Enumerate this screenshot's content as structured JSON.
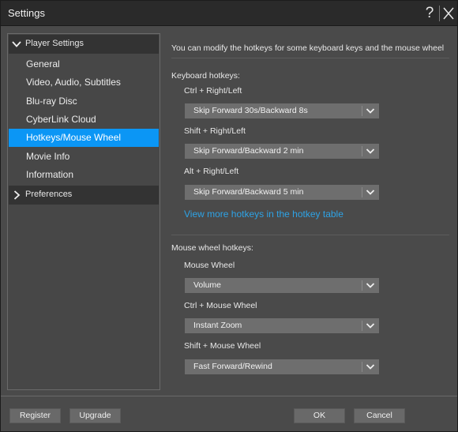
{
  "window": {
    "title": "Settings",
    "help_label": "?",
    "icons": {
      "help": "question-mark-icon",
      "close": "close-x-icon"
    }
  },
  "sidebar": {
    "groups": [
      {
        "label": "Player Settings",
        "expanded": true,
        "icon": "chevron-down-icon",
        "items": [
          {
            "label": "General",
            "active": false
          },
          {
            "label": "Video, Audio, Subtitles",
            "active": false
          },
          {
            "label": "Blu-ray Disc",
            "active": false
          },
          {
            "label": "CyberLink Cloud",
            "active": false
          },
          {
            "label": "Hotkeys/Mouse Wheel",
            "active": true
          },
          {
            "label": "Movie Info",
            "active": false
          },
          {
            "label": "Information",
            "active": false
          }
        ]
      },
      {
        "label": "Preferences",
        "expanded": false,
        "icon": "chevron-right-icon",
        "items": []
      }
    ]
  },
  "main": {
    "intro": "You can modify the hotkeys for some keyboard keys and the mouse wheel",
    "keyboard": {
      "heading": "Keyboard hotkeys:",
      "entries": [
        {
          "label": "Ctrl + Right/Left",
          "value": "Skip Forward 30s/Backward 8s"
        },
        {
          "label": "Shift + Right/Left",
          "value": "Skip Forward/Backward 2 min"
        },
        {
          "label": "Alt + Right/Left",
          "value": "Skip Forward/Backward 5 min"
        }
      ],
      "link": "View more hotkeys in the hotkey table"
    },
    "mouse": {
      "heading": "Mouse wheel hotkeys:",
      "entries": [
        {
          "label": "Mouse Wheel",
          "value": "Volume"
        },
        {
          "label": "Ctrl + Mouse Wheel",
          "value": "Instant Zoom"
        },
        {
          "label": "Shift + Mouse Wheel",
          "value": "Fast Forward/Rewind"
        }
      ]
    }
  },
  "footer": {
    "register": "Register",
    "upgrade": "Upgrade",
    "ok": "OK",
    "cancel": "Cancel"
  },
  "colors": {
    "accent": "#0b96f5",
    "link": "#2ea3e6",
    "background": "#4a4a4a",
    "titlebar": "#2a2a2a"
  }
}
